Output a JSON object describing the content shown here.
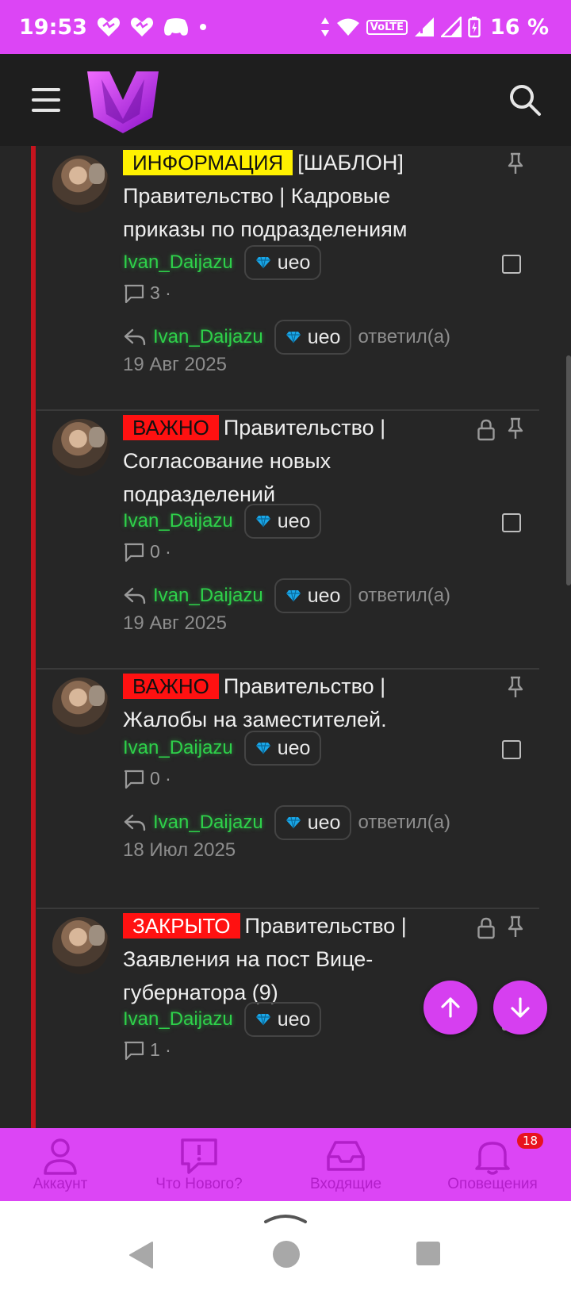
{
  "status_bar": {
    "time": "19:53",
    "volte": "VoLTE",
    "battery": "16 %"
  },
  "header": {
    "logo_letter": "M"
  },
  "threads": [
    {
      "prefix": "ИНФОРМАЦИЯ",
      "title": "[ШАБЛОН] Правительство | Кадровые приказы по подразделениям",
      "author": "Ivan_Daijazu",
      "rank": "ueo",
      "replies": "3 ·",
      "last_poster": "Ivan_Daijazu",
      "last_rank": "ueo",
      "replied_label": "ответил(а)",
      "date": "19 Авг 2025",
      "locked": false
    },
    {
      "prefix": "ВАЖНО",
      "title": "Правительство | Согласование новых подразделений",
      "author": "Ivan_Daijazu",
      "rank": "ueo",
      "replies": "0 ·",
      "last_poster": "Ivan_Daijazu",
      "last_rank": "ueo",
      "replied_label": "ответил(а)",
      "date": "19 Авг 2025",
      "locked": true
    },
    {
      "prefix": "ВАЖНО",
      "title": "Правительство | Жалобы на заместителей.",
      "author": "Ivan_Daijazu",
      "rank": "ueo",
      "replies": "0 ·",
      "last_poster": "Ivan_Daijazu",
      "last_rank": "ueo",
      "replied_label": "ответил(а)",
      "date": "18 Июл 2025",
      "locked": false
    },
    {
      "prefix": "ЗАКРЫТО",
      "title": "Правительство | Заявления на пост Вице-губернатора (9)",
      "author": "Ivan_Daijazu",
      "rank": "ueo",
      "replies": "1 ·",
      "locked": true
    }
  ],
  "bottom_nav": {
    "account": "Аккаунт",
    "whats_new": "Что Нового?",
    "inbox": "Входящие",
    "alerts": "Оповещения",
    "alerts_count": "18"
  },
  "colors": {
    "accent": "#dc45f5",
    "username": "#2ed14a",
    "sticky_line": "#c4141e",
    "badge_info": "#fff100",
    "badge_red": "#ff1111"
  }
}
